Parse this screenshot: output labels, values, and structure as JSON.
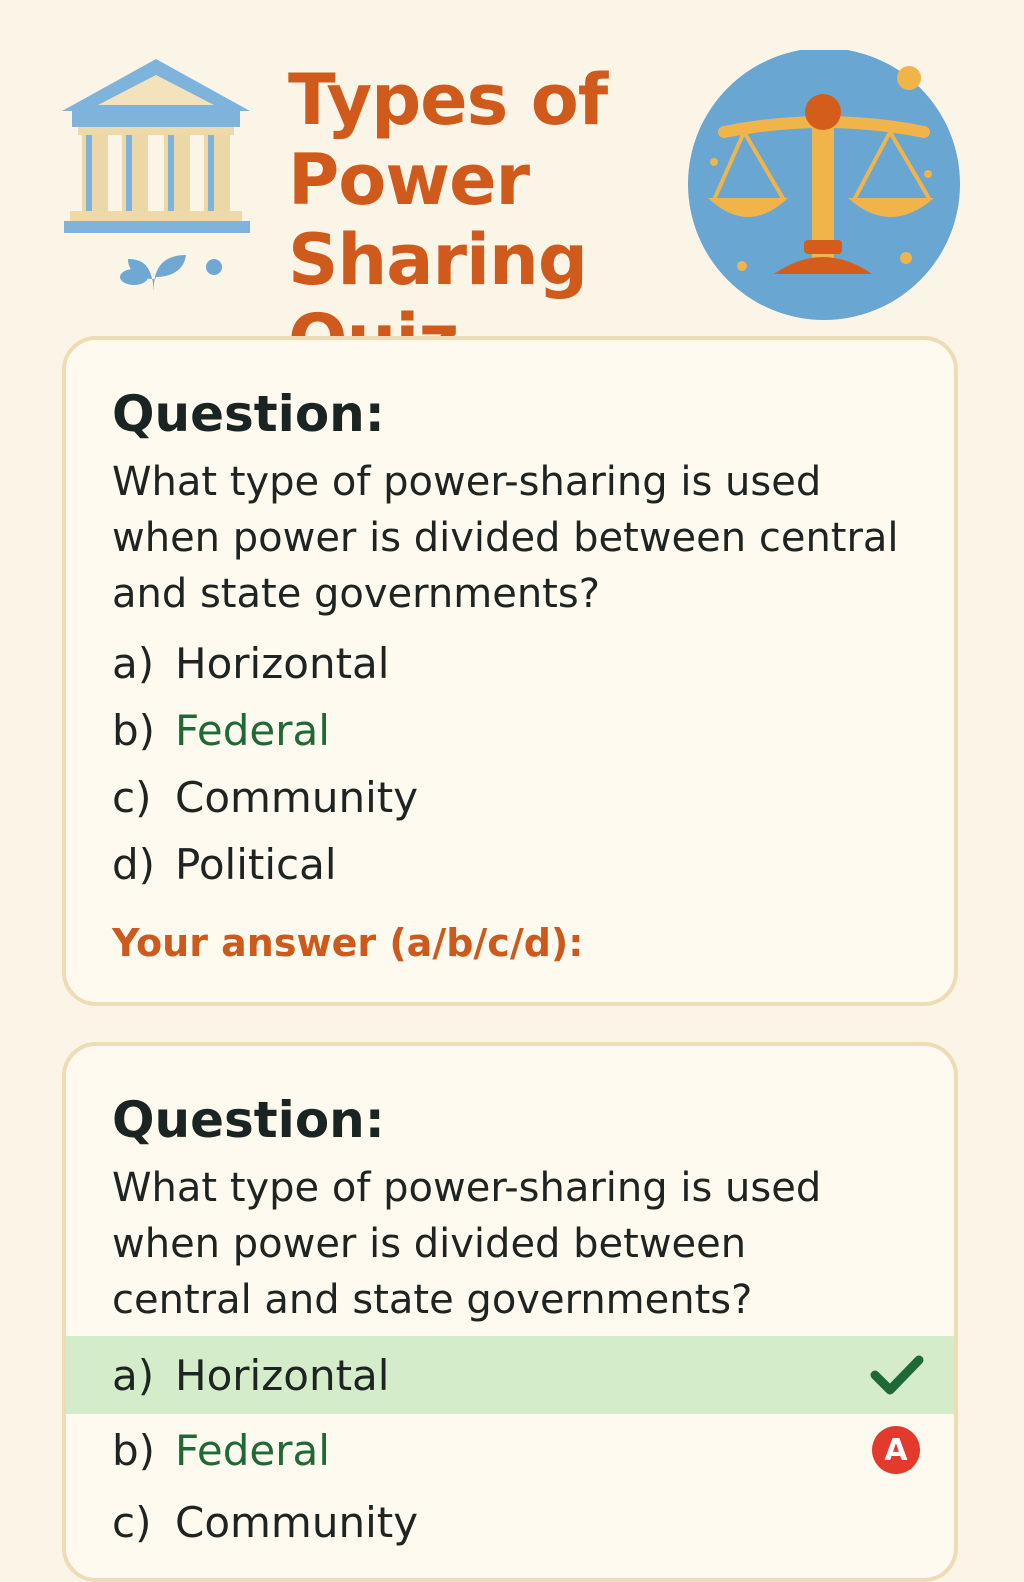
{
  "header": {
    "title": "Types of Power Sharing Quiz",
    "left_icon": "classical-building-icon",
    "right_icon": "balance-scale-icon"
  },
  "questions": [
    {
      "label": "Question:",
      "text": "What type of power-sharing is used when power is divided between central and state governments?",
      "options": [
        {
          "letter": "a)",
          "text": "Horizontal"
        },
        {
          "letter": "b)",
          "text": "Federal"
        },
        {
          "letter": "c)",
          "text": "Community"
        },
        {
          "letter": "d)",
          "text": "Political"
        }
      ],
      "answer_prompt": "Your answer (a/b/c/d):"
    },
    {
      "label": "Question:",
      "text": "What type of power-sharing is used when power is divided between central and state governments?",
      "options": [
        {
          "letter": "a)",
          "text": "Horizontal",
          "state": "selected",
          "icon": "checkmark-icon"
        },
        {
          "letter": "b)",
          "text": "Federal",
          "badge": "A"
        },
        {
          "letter": "c)",
          "text": "Community"
        }
      ]
    }
  ],
  "colors": {
    "background": "#fbf5e8",
    "title": "#cf5a1b",
    "card_border": "#eddcb6",
    "correct_text": "#1f6a34",
    "selected_row": "#d4ecc9",
    "check": "#1f6a34",
    "badge": "#e23b2e",
    "answer_prompt": "#cd5a1c",
    "icon_blue": "#6fa8d3",
    "icon_gold": "#f0b548"
  }
}
